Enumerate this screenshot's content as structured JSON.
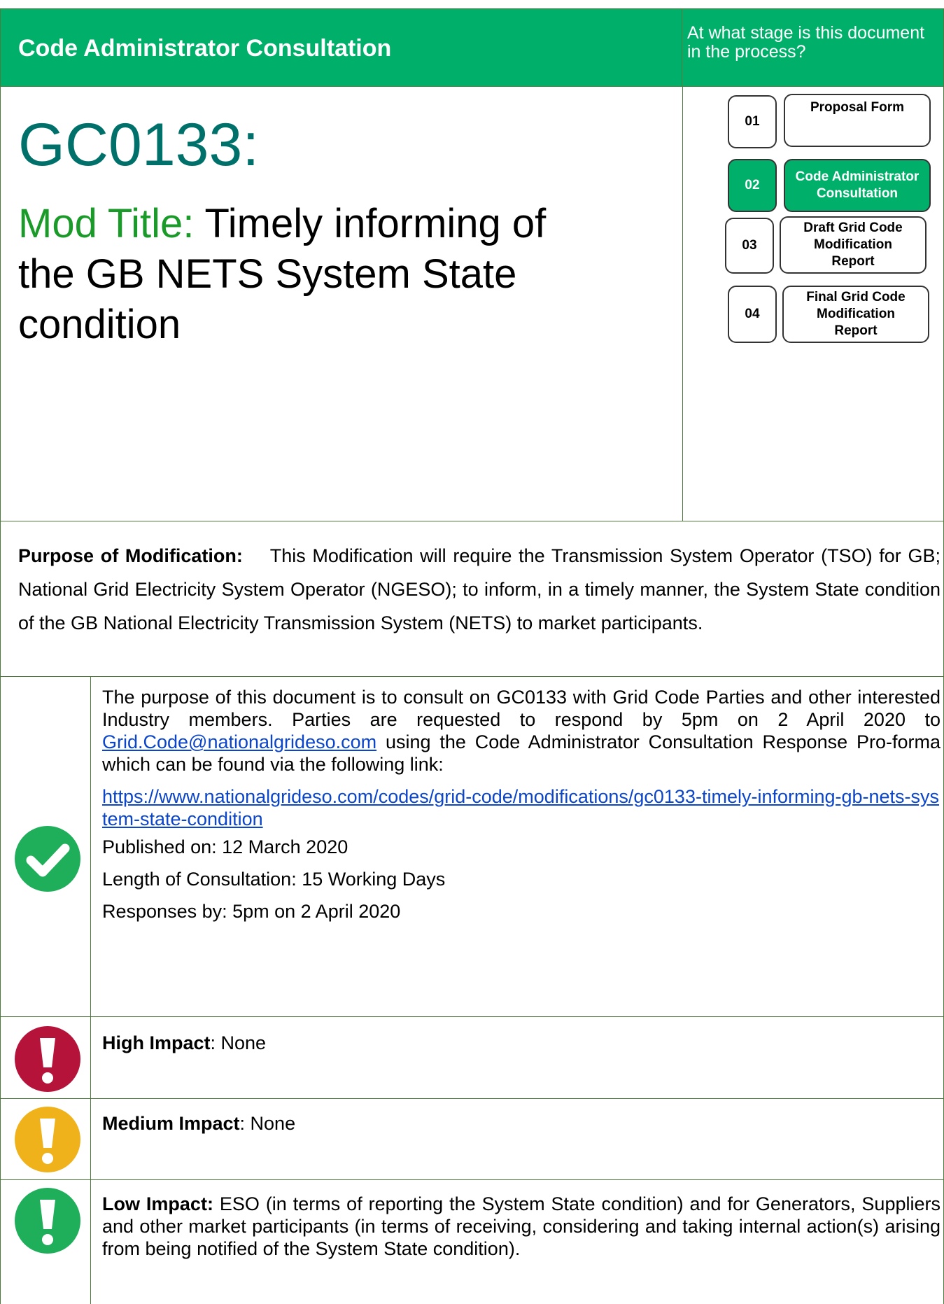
{
  "header": {
    "title": "Code Administrator Consultation",
    "question": "At what stage is this document in the process?"
  },
  "modification": {
    "id": "GC0133:",
    "title_label": "Mod Title:",
    "title_line1": "Timely informing of",
    "title_line2": "the GB NETS System State",
    "title_line3": "condition"
  },
  "stages": [
    {
      "number": "01",
      "label": "Proposal Form"
    },
    {
      "number": "02",
      "label_line1": "Code Administrator",
      "label_line2": "Consultation"
    },
    {
      "number": "03",
      "label_line1": "Draft Grid Code",
      "label_line2": "Modification",
      "label_line3": "Report"
    },
    {
      "number": "04",
      "label_line1": "Final Grid Code",
      "label_line2": "Modification",
      "label_line3": "Report"
    }
  ],
  "purpose": {
    "label": "Purpose of Modification:",
    "text": "This Modification will require the Transmission System Operator (TSO) for GB; National Grid Electricity System Operator (NGESO); to inform, in a timely manner, the System State condition of the GB National Electricity Transmission System (NETS) to market participants."
  },
  "consultation": {
    "intro_a": "The purpose of this document is to consult on GC0133 with Grid Code Parties and other interested Industry members. Parties are requested to respond by 5pm on 2 April 2020 to ",
    "email": "Grid.Code@nationalgrideso.com",
    "intro_b": " using the Code Administrator Consultation Response Pro-forma which can be found via the following link:",
    "link": "https://www.nationalgrideso.com/codes/grid-code/modifications/gc0133-timely-informing-gb-nets-system-state-condition",
    "published": "Published on: 12 March 2020",
    "length": "Length of Consultation:  15 Working Days",
    "responses": "Responses by: 5pm on 2 April 2020"
  },
  "impacts": {
    "high_label": "High Impact",
    "high_text": ": None",
    "medium_label": "Medium Impact",
    "medium_text": ": None",
    "low_label": "Low Impact:",
    "low_text": "  ESO (in terms of reporting the System State condition) and for Generators, Suppliers and other market participants (in terms of receiving, considering and taking internal action(s) arising from being notified of the System State condition)."
  },
  "colors": {
    "brand_green": "#00b06a",
    "mod_id_teal": "#00706a",
    "label_green": "#1a9a28",
    "high_red": "#b5133a",
    "medium_amber": "#f0b21a",
    "low_green": "#1fae5a"
  },
  "icons": {
    "check": "check-circle-icon",
    "high": "exclamation-red-icon",
    "medium": "exclamation-amber-icon",
    "low": "exclamation-green-icon"
  }
}
